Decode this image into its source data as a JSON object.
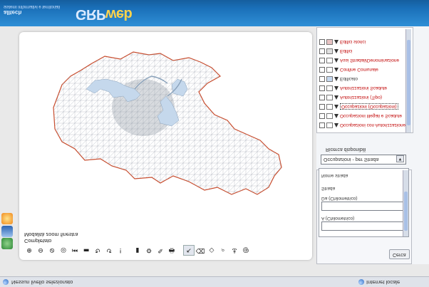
{
  "statusbar": {
    "left_text": "Nessun livello selezionato",
    "right_text": "Internet locale"
  },
  "launcher_icons": [
    "arrows-icon",
    "book-icon",
    "globe-icon"
  ],
  "map": {
    "toolbar_icons": [
      "zoom-in-icon",
      "zoom-out-icon",
      "zoom-previous-icon",
      "full-extent-icon",
      "rewind-icon",
      "ruler-icon",
      "refresh-icon",
      "refresh-alt-icon",
      "info-icon",
      "layers-icon",
      "identify-icon",
      "pencil-icon",
      "print-icon",
      "pointer-icon",
      "eraser-icon",
      "code-icon",
      "search-icon",
      "hook-icon",
      "at-icon"
    ],
    "toolbar_glyphs": [
      "⊕",
      "⊖",
      "⊘",
      "◎",
      "⏮",
      "▬",
      "↻",
      "↺",
      "!",
      "▮",
      "⚙",
      "✎",
      "🖶",
      "↖",
      "⌫",
      "◇",
      "⌕",
      "⚓",
      "@"
    ],
    "pressed_tool_index": 13,
    "info_lines": [
      "Modalità zoom finestra",
      "Completato"
    ]
  },
  "search": {
    "tab_label": "Cerca",
    "field1_label": "A (Chilometrico)",
    "field2_label": "Da (Chilometrico)",
    "field3_label": "Strada",
    "field4_label": "Nome strada"
  },
  "layer_select": {
    "label": "Ricerca disponibili",
    "value": "Occupazioni - per Strada"
  },
  "layers": [
    {
      "name": "Occupazioni con Autorizzazione",
      "color": "#c00000",
      "swatch": "#ffffff"
    },
    {
      "name": "Occupazioni Illegali e Scadute",
      "color": "#c00000",
      "swatch": "#ffffff"
    },
    {
      "name": "Occupazioni (Occupazioni)",
      "color": "#c00000",
      "swatch": "#ffffff",
      "selected": true
    },
    {
      "name": "Autorizzazioni (Tipo)",
      "color": "#c00000",
      "swatch": "#ffffff"
    },
    {
      "name": "Autorizzazioni Scadute",
      "color": "#c00000",
      "swatch": "#ffffff"
    },
    {
      "name": "Edificato",
      "color": "#333333",
      "swatch": "#c7d9f0"
    },
    {
      "name": "Confine Comunale",
      "color": "#c00000",
      "swatch": "#ffffff"
    },
    {
      "name": "Assi Stradali/Denominazione",
      "color": "#c00000",
      "swatch": "#ffffff"
    },
    {
      "name": "Edifici",
      "color": "#c00000",
      "swatch": "#e0e0e0"
    },
    {
      "name": "Edifici storici",
      "color": "#c00000",
      "swatch": "#e8c3c3"
    }
  ],
  "banner": {
    "brand_primary": "GRP",
    "brand_secondary": "web",
    "company": "alltech",
    "tagline": "sistemi informativi e territoriali"
  }
}
